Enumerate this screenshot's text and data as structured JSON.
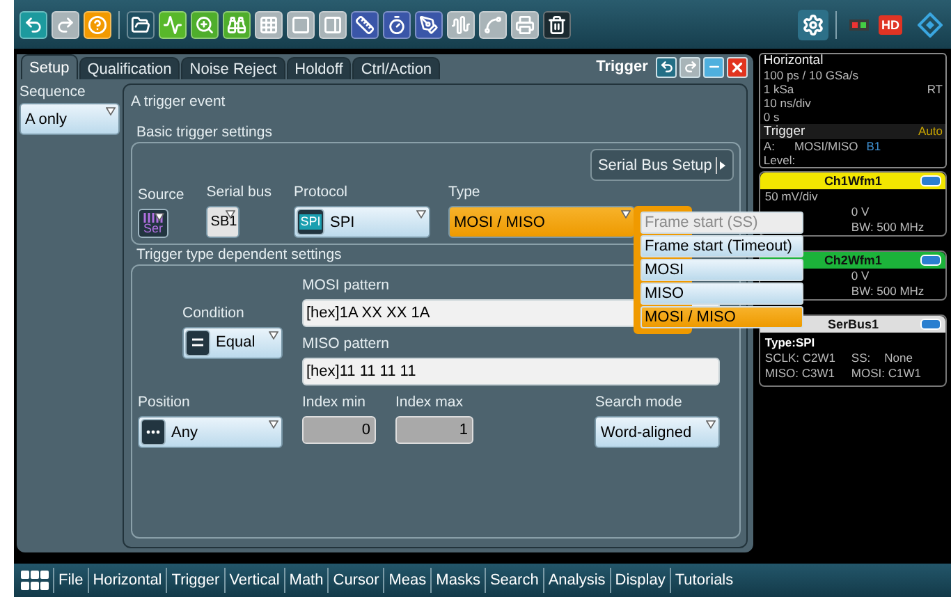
{
  "toolbar": {
    "tools": [
      {
        "kind": "undo",
        "color": "#1d9a9e"
      },
      {
        "kind": "redo",
        "color": "#a9b4b8"
      },
      {
        "kind": "help",
        "color": "#f29a00"
      },
      {
        "kind": "open",
        "color": "#1e4e60"
      },
      {
        "kind": "waveform",
        "color": "#58b82a"
      },
      {
        "kind": "zoom",
        "color": "#4fae2c"
      },
      {
        "kind": "binoculars",
        "color": "#4fae2c"
      },
      {
        "kind": "grid",
        "color": "#a9b4b8"
      },
      {
        "kind": "frame",
        "color": "#a9b4b8"
      },
      {
        "kind": "gate",
        "color": "#a9b4b8"
      },
      {
        "kind": "cursor",
        "color": "#3a56a8"
      },
      {
        "kind": "timer",
        "color": "#3a56a8"
      },
      {
        "kind": "probe",
        "color": "#3a56a8"
      },
      {
        "kind": "fft",
        "color": "#a9b4b8"
      },
      {
        "kind": "spectrum",
        "color": "#a9b4b8"
      },
      {
        "kind": "print",
        "color": "#a9b4b8"
      },
      {
        "kind": "trash",
        "color": "#1b2a30"
      }
    ],
    "hd_badge": "HD"
  },
  "dialog": {
    "title": "Trigger",
    "tabs": [
      {
        "label": "Setup",
        "selected": true
      },
      {
        "label": "Qualification",
        "selected": false
      },
      {
        "label": "Noise Reject",
        "selected": false
      },
      {
        "label": "Holdoff",
        "selected": false
      },
      {
        "label": "Ctrl/Action",
        "selected": false
      }
    ],
    "sequence": {
      "label": "Sequence",
      "value": "A only"
    },
    "heading": "A trigger event",
    "basic": {
      "title": "Basic trigger settings",
      "setup_button": "Serial Bus Setup",
      "source": {
        "label": "Source",
        "icon_text": "Ser"
      },
      "serial_bus": {
        "label": "Serial bus",
        "value": "SB1"
      },
      "protocol": {
        "label": "Protocol",
        "icon_text": "SPI",
        "value": "SPI"
      },
      "type": {
        "label": "Type",
        "value": "MOSI / MISO",
        "expanded": true,
        "options": [
          {
            "label": "Frame start (SS)",
            "disabled": true,
            "selected": false
          },
          {
            "label": "Frame start (Timeout)",
            "disabled": false,
            "selected": false
          },
          {
            "label": "MOSI",
            "disabled": false,
            "selected": false
          },
          {
            "label": "MISO",
            "disabled": false,
            "selected": false
          },
          {
            "label": "MOSI / MISO",
            "disabled": false,
            "selected": true
          }
        ]
      }
    },
    "dependent": {
      "title": "Trigger type dependent settings",
      "condition": {
        "label": "Condition",
        "value": "Equal"
      },
      "mosi_pattern": {
        "label": "MOSI pattern",
        "value": "[hex]1A XX XX 1A"
      },
      "miso_pattern": {
        "label": "MISO pattern",
        "value": "[hex]11 11 11 11"
      },
      "position": {
        "label": "Position",
        "value": "Any"
      },
      "index_min": {
        "label": "Index min",
        "value": "0"
      },
      "index_max": {
        "label": "Index max",
        "value": "1"
      },
      "search_mode": {
        "label": "Search mode",
        "value": "Word-aligned"
      }
    }
  },
  "info": {
    "horizontal": {
      "title": "Horizontal",
      "lines": [
        {
          "left": "100 ps / 10 GSa/s"
        },
        {
          "left": "1 kSa",
          "right": "RT"
        },
        {
          "left": "10 ns/div"
        },
        {
          "left": "0 s"
        }
      ]
    },
    "trigger": {
      "title": "Trigger",
      "mode": "Auto",
      "source_label": "A:",
      "type": "MOSI/MISO",
      "bus": "B1",
      "level_label": "Level:"
    },
    "cards": [
      {
        "kind": "channel",
        "title": "Ch1Wfm1",
        "color": "#f2e600",
        "rows": [
          {
            "left": "50 mV/div"
          },
          {
            "right": "0 V"
          },
          {
            "right": "BW: 500 MHz"
          }
        ]
      },
      {
        "kind": "channel",
        "title": "Ch2Wfm1",
        "color": "#1cb33a",
        "rows": [
          {
            "right": "0 V"
          },
          {
            "right": "BW: 500 MHz"
          }
        ]
      },
      {
        "kind": "bus",
        "title": "SerBus1",
        "color": "#dedede",
        "type": "Type:SPI",
        "rows": [
          [
            "SCLK: C2W1",
            "SS:",
            "None"
          ],
          [
            "MISO: C3W1",
            "MOSI: C1W1"
          ]
        ]
      }
    ]
  },
  "menu_bar": {
    "items": [
      "File",
      "Horizontal",
      "Trigger",
      "Vertical",
      "Math",
      "Cursor",
      "Meas",
      "Masks",
      "Search",
      "Analysis",
      "Display",
      "Tutorials"
    ]
  }
}
